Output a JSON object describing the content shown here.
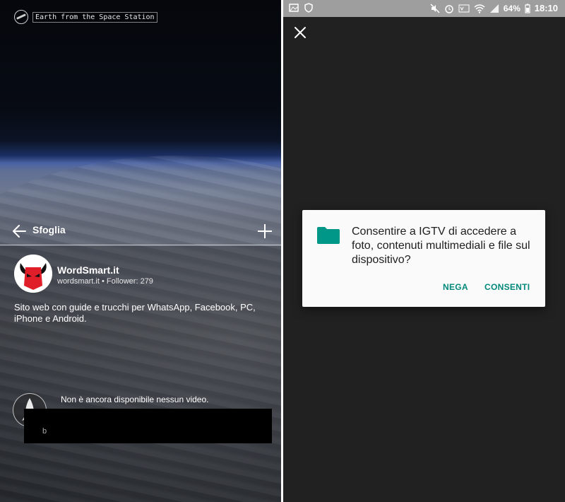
{
  "left": {
    "watermark": "Earth from the Space Station",
    "topbar": {
      "title": "Sfoglia"
    },
    "profile": {
      "name": "WordSmart.it",
      "handle": "wordsmart.it",
      "separator": "•",
      "followers": "Follower: 279",
      "bio": "Sito web con guide e trucchi per WhatsApp, Facebook, PC, iPhone e Android."
    },
    "empty_state": {
      "message": "Non è ancora disponibile nessun video.",
      "box_text": "b"
    }
  },
  "right": {
    "status_bar": {
      "battery": "64%",
      "time": "18:10",
      "icons": [
        "gallery-icon",
        "shield-icon",
        "mute-icon",
        "alarm-icon",
        "volte-icon",
        "wifi-icon",
        "signal-icon",
        "battery-icon"
      ]
    },
    "dialog": {
      "message": "Consentire a IGTV di accedere a foto, contenuti multimediali e file sul dispositivo?",
      "deny_label": "NEGA",
      "allow_label": "CONSENTI",
      "accent": "#00897b"
    }
  }
}
